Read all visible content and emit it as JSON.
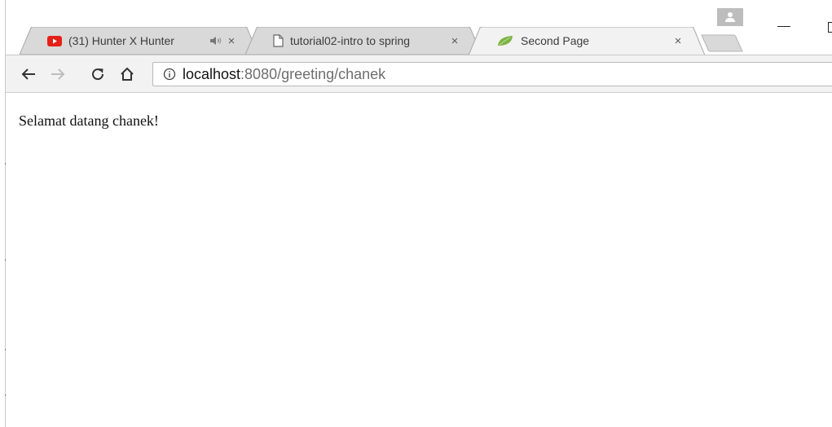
{
  "tabs": [
    {
      "title": "(31) Hunter X Hunter",
      "icon": "youtube-icon",
      "audio": true,
      "active": false
    },
    {
      "title": "tutorial02-intro to spring",
      "icon": "document-icon",
      "audio": false,
      "active": false
    },
    {
      "title": "Second Page",
      "icon": "spring-leaf-icon",
      "audio": false,
      "active": true
    }
  ],
  "tab_close_glyph": "×",
  "omnibox": {
    "host": "localhost",
    "path": ":8080/greeting/chanek"
  },
  "page": {
    "greeting": "Selamat datang chanek!"
  },
  "colors": {
    "tab_inactive": "#d9d9d9",
    "tab_active": "#f2f2f2",
    "toolbar": "#f2f2f2",
    "youtube_red": "#e62117",
    "spring_green": "#7cb342"
  }
}
